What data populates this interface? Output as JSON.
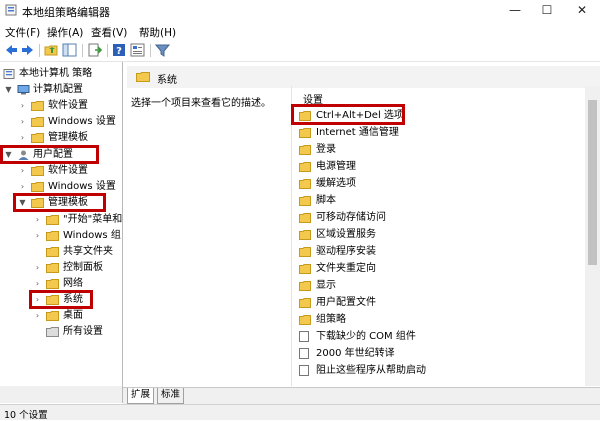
{
  "window": {
    "title": "本地组策略编辑器",
    "minimize": "—",
    "maximize": "☐",
    "close": "✕"
  },
  "menu": {
    "file": "文件(F)",
    "action": "操作(A)",
    "view": "查看(V)",
    "help": "帮助(H)"
  },
  "toolbar": {
    "icons": [
      "back-arrow-icon",
      "forward-arrow-icon",
      "up-folder-icon",
      "show-hide-tree-icon",
      "export-list-icon",
      "help-icon",
      "properties-icon",
      "filter-icon"
    ]
  },
  "tree": {
    "root": "本地计算机 策略",
    "computer_config": "计算机配置",
    "cc_software": "软件设置",
    "cc_windows": "Windows 设置",
    "cc_admin": "管理模板",
    "user_config": "用户配置",
    "uc_software": "软件设置",
    "uc_windows": "Windows 设置",
    "uc_admin": "管理模板",
    "start_menu": "\"开始\"菜单和",
    "windows_comp": "Windows 组",
    "shared": "共享文件夹",
    "control_panel": "控制面板",
    "network": "网络",
    "system": "系统",
    "desktop": "桌面",
    "all_settings": "所有设置"
  },
  "right": {
    "header": "系统",
    "description": "选择一个项目来查看它的描述。",
    "column": "设置",
    "items": [
      "Ctrl+Alt+Del 选项",
      "Internet 通信管理",
      "登录",
      "电源管理",
      "缓解选项",
      "脚本",
      "可移动存储访问",
      "区域设置服务",
      "驱动程序安装",
      "文件夹重定向",
      "显示",
      "用户配置文件",
      "组策略",
      "下载缺少的 COM 组件",
      "2000 年世纪转译",
      "阻止这些程序从帮助启动"
    ]
  },
  "tabs": {
    "extended": "扩展",
    "standard": "标准"
  },
  "status": {
    "text": "10 个设置"
  },
  "colors": {
    "highlight": "#c00000",
    "folder": "#f2c94c",
    "header_bg": "#f3f3f3"
  }
}
